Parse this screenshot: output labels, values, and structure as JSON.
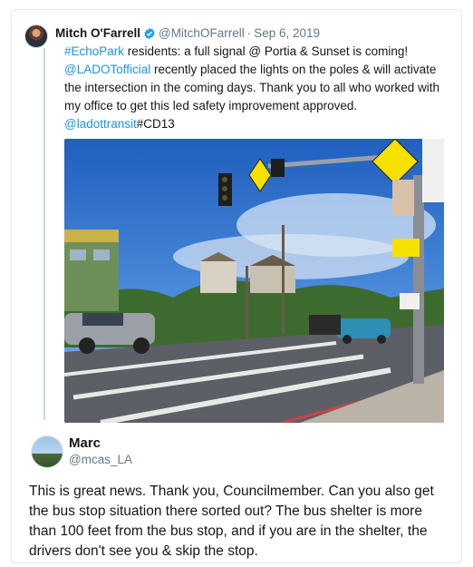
{
  "original_tweet": {
    "display_name": "Mitch O'Farrell",
    "handle": "@MitchOFarrell",
    "separator": "·",
    "date": "Sep 6, 2019",
    "text": {
      "part1": "#EchoPark",
      "part2": " residents: a full signal @ Portia & Sunset is coming! ",
      "part3": "@LADOTofficial",
      "part4": " recently placed the lights on the poles & will activate the intersection in the coming days. Thank you to all who worked with my office to get this led safety improvement approved. ",
      "part5": "@ladottransit",
      "part6": "#CD13"
    },
    "photo_description": "street-intersection-photo"
  },
  "reply": {
    "display_name": "Marc",
    "handle": "@mcas_LA",
    "text": "This is great news. Thank you, Councilmember. Can you also get the bus stop situation there sorted out? The bus shelter is more than 100 feet from the bus stop, and if you are in the shelter, the drivers don't see you & skip the stop."
  },
  "colors": {
    "link": "#1b95e0",
    "verified": "#1da1f2",
    "secondary_text": "#657786",
    "thread_line": "#c4d8e6"
  },
  "icons": {
    "verified": "verified-badge-icon"
  }
}
